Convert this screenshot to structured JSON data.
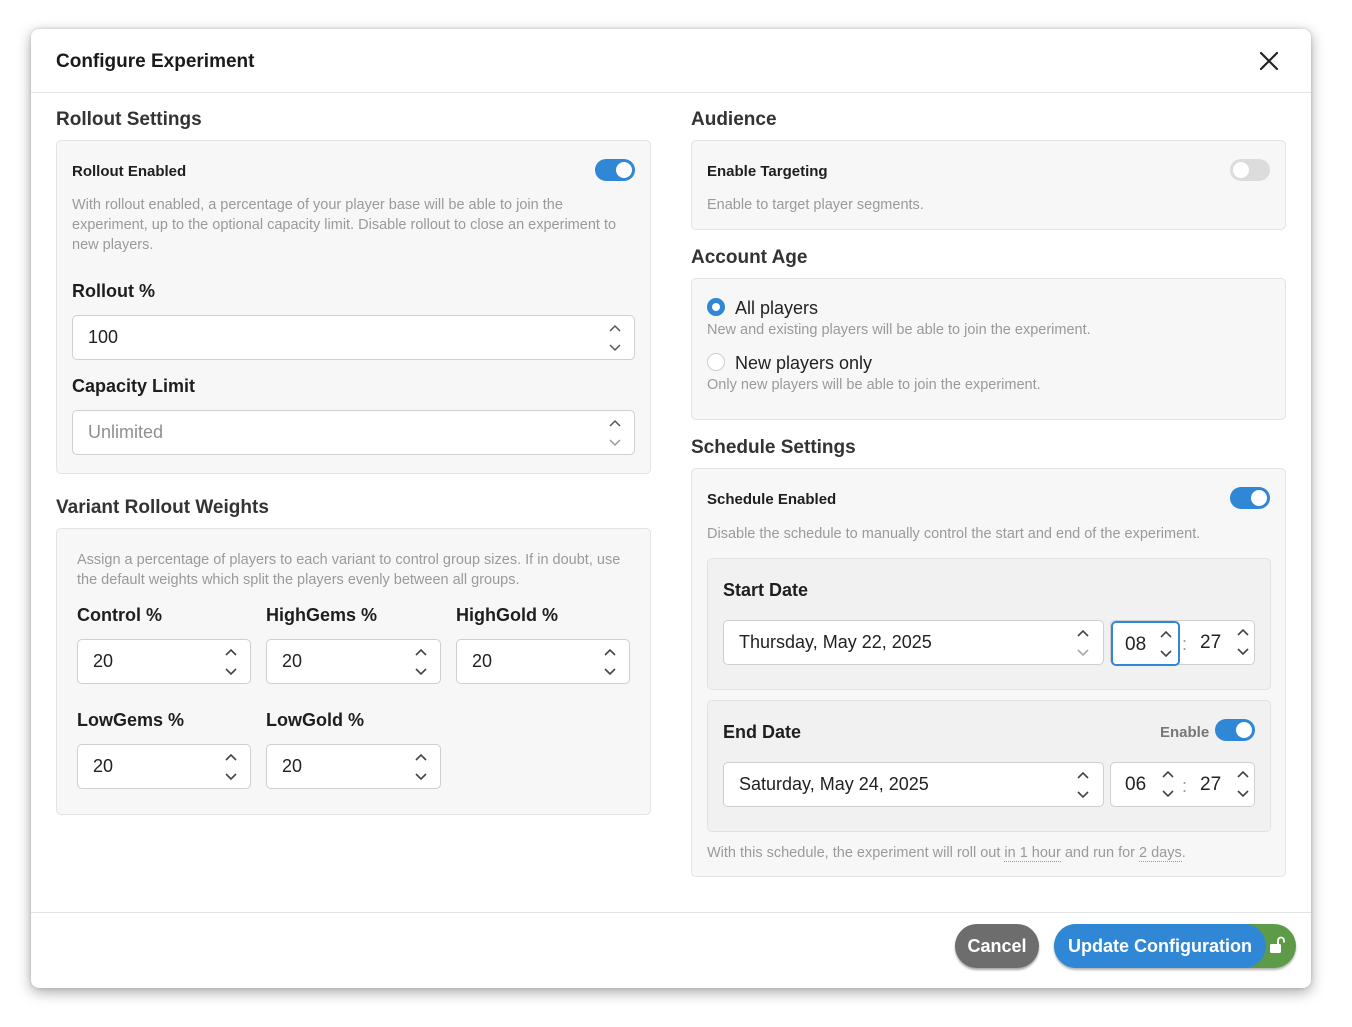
{
  "dialog": {
    "title": "Configure Experiment"
  },
  "rollout": {
    "section_title": "Rollout Settings",
    "enabled_label": "Rollout Enabled",
    "enabled": true,
    "description": "With rollout enabled, a percentage of your player base will be able to join the experiment, up to the optional capacity limit. Disable rollout to close an experiment to new players.",
    "percent_label": "Rollout %",
    "percent_value": "100",
    "capacity_label": "Capacity Limit",
    "capacity_placeholder": "Unlimited"
  },
  "variants": {
    "section_title": "Variant Rollout Weights",
    "description": "Assign a percentage of players to each variant to control group sizes. If in doubt, use the default weights which split the players evenly between all groups.",
    "items": [
      {
        "label": "Control %",
        "value": "20"
      },
      {
        "label": "HighGems %",
        "value": "20"
      },
      {
        "label": "HighGold %",
        "value": "20"
      },
      {
        "label": "LowGems %",
        "value": "20"
      },
      {
        "label": "LowGold %",
        "value": "20"
      }
    ]
  },
  "audience": {
    "section_title": "Audience",
    "targeting_label": "Enable Targeting",
    "targeting_enabled": false,
    "targeting_description": "Enable to target player segments."
  },
  "account_age": {
    "section_title": "Account Age",
    "options": [
      {
        "label": "All players",
        "description": "New and existing players will be able to join the experiment.",
        "selected": true
      },
      {
        "label": "New players only",
        "description": "Only new players will be able to join the experiment.",
        "selected": false
      }
    ]
  },
  "schedule": {
    "section_title": "Schedule Settings",
    "enabled_label": "Schedule Enabled",
    "enabled": true,
    "description": "Disable the schedule to manually control the start and end of the experiment.",
    "start": {
      "label": "Start Date",
      "date": "Thursday, May 22, 2025",
      "hour": "08",
      "minute": "27"
    },
    "end": {
      "label": "End Date",
      "enable_label": "Enable",
      "enabled": true,
      "date": "Saturday, May 24, 2025",
      "hour": "06",
      "minute": "27"
    },
    "summary_prefix": "With this schedule, the experiment will roll out ",
    "summary_rollout": "in 1 hour",
    "summary_middle": " and run for ",
    "summary_duration": "2 days",
    "summary_suffix": "."
  },
  "footer": {
    "cancel_label": "Cancel",
    "update_label": "Update Configuration"
  },
  "colors": {
    "accent": "#2f87d6",
    "cancel": "#6d6d6d",
    "lock_green": "#5e9b49"
  },
  "icons": [
    "close-icon",
    "chevron-up-icon",
    "chevron-down-icon",
    "lock-open-icon"
  ]
}
